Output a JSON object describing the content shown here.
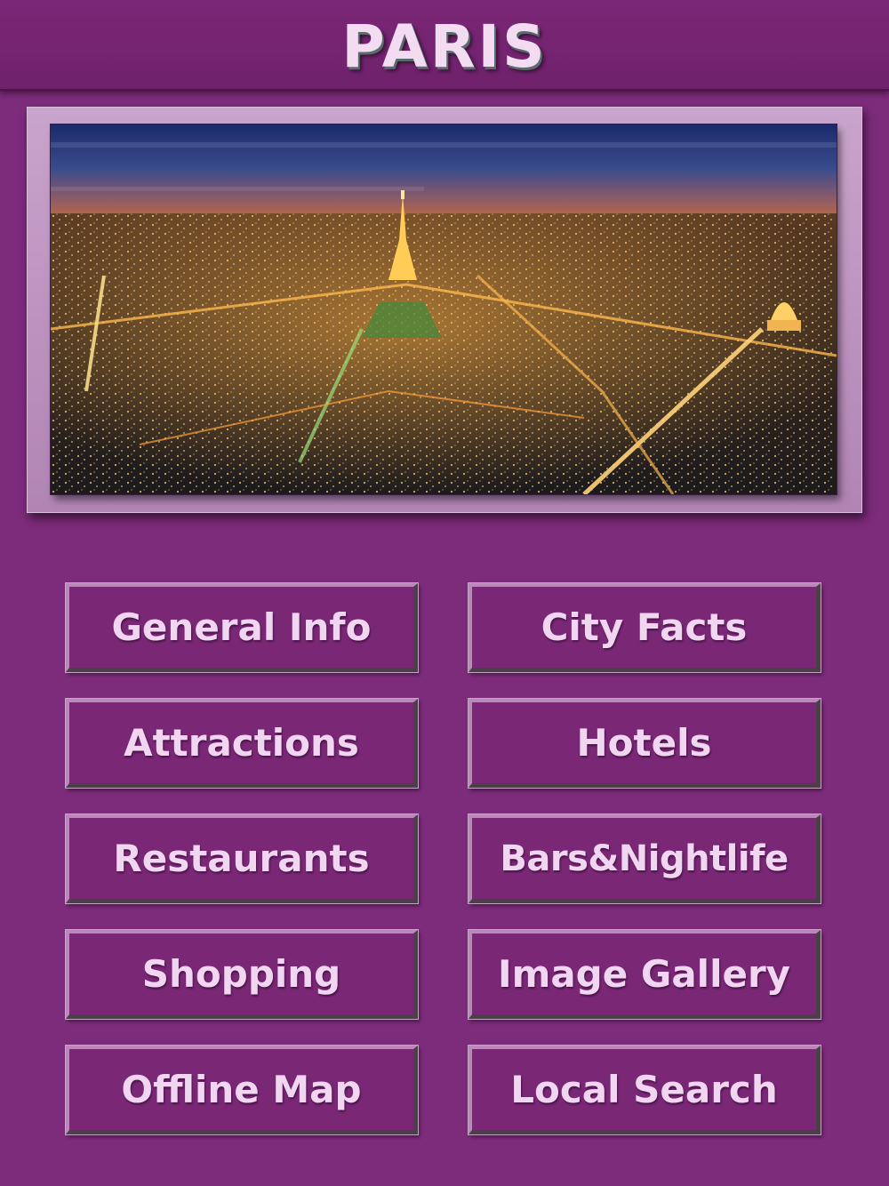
{
  "header": {
    "title": "PARIS"
  },
  "hero": {
    "image": "paris-night-skyline-eiffel-tower"
  },
  "menu": {
    "items": [
      {
        "label": "General Info"
      },
      {
        "label": "City Facts"
      },
      {
        "label": "Attractions"
      },
      {
        "label": "Hotels"
      },
      {
        "label": "Restaurants"
      },
      {
        "label": "Bars&Nightlife"
      },
      {
        "label": "Shopping"
      },
      {
        "label": "Image Gallery"
      },
      {
        "label": "Offline Map"
      },
      {
        "label": "Local Search"
      }
    ]
  },
  "colors": {
    "background": "#7d2b7b",
    "button": "#7a2876",
    "text": "#f1d6f1",
    "frame": "#c9a4cc"
  }
}
